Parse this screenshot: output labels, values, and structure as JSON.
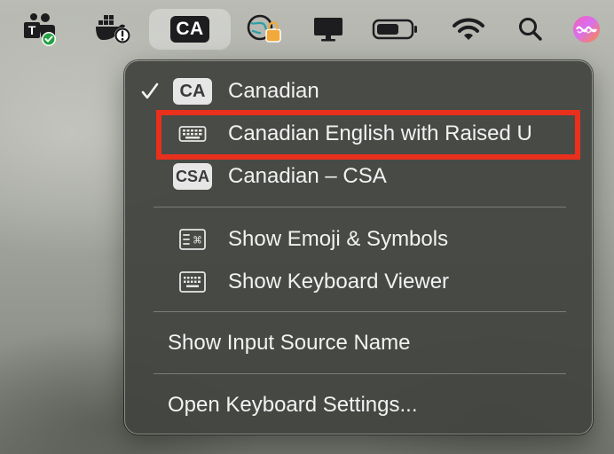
{
  "menubar": {
    "icons": [
      {
        "name": "teams-icon",
        "badge": "T"
      },
      {
        "name": "docker-warning-icon"
      },
      {
        "name": "input-source-icon",
        "label": "CA"
      },
      {
        "name": "vpn-lock-icon"
      },
      {
        "name": "display-icon"
      },
      {
        "name": "battery-icon"
      },
      {
        "name": "wifi-icon"
      },
      {
        "name": "search-icon"
      },
      {
        "name": "siri-icon"
      }
    ]
  },
  "menu": {
    "sources": [
      {
        "badge": "CA",
        "label": "Canadian",
        "checked": true
      },
      {
        "icon": "keyboard-icon",
        "label": "Canadian English with Raised U",
        "checked": false
      },
      {
        "badge": "CSA",
        "label": "Canadian – CSA",
        "checked": false
      }
    ],
    "tools": [
      {
        "icon": "emoji-symbols-icon",
        "label": "Show Emoji & Symbols"
      },
      {
        "icon": "keyboard-viewer-icon",
        "label": "Show Keyboard Viewer"
      }
    ],
    "show_name": "Show Input Source Name",
    "settings": "Open Keyboard Settings..."
  },
  "colors": {
    "highlight": "#e8301c",
    "menu_bg": "#424440",
    "text": "#f2f2f2"
  }
}
